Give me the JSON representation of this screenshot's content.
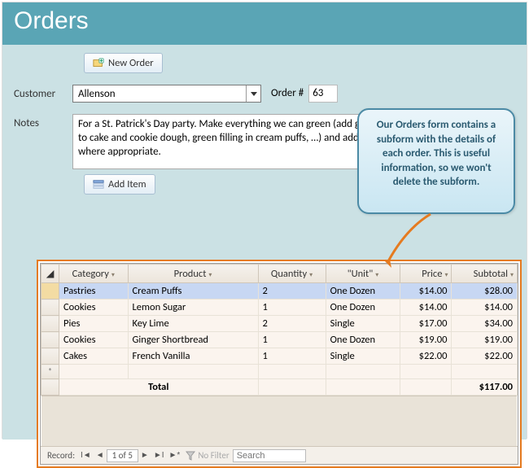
{
  "header": {
    "title": "Orders"
  },
  "buttons": {
    "newOrder": "New Order",
    "addItem": "Add Item"
  },
  "labels": {
    "customer": "Customer",
    "notes": "Notes",
    "orderNum": "Order #",
    "total": "Total",
    "filter": "No Filter"
  },
  "customer": {
    "value": "Allenson"
  },
  "orderNum": "63",
  "notes": "For a St. Patrick's Day party. Make everything we can green (add green food coloring to cake and cookie dough, green filling in cream puffs, …) and add on green sprinkles where appropriate.",
  "columns": {
    "category": "Category",
    "product": "Product",
    "quantity": "Quantity",
    "unit": "\"Unit\"",
    "price": "Price",
    "subtotal": "Subtotal"
  },
  "rows": [
    {
      "category": "Pastries",
      "product": "Cream Puffs",
      "quantity": "2",
      "unit": "One Dozen",
      "price": "$14.00",
      "subtotal": "$28.00"
    },
    {
      "category": "Cookies",
      "product": "Lemon Sugar",
      "quantity": "1",
      "unit": "One Dozen",
      "price": "$14.00",
      "subtotal": "$14.00"
    },
    {
      "category": "Pies",
      "product": "Key Lime",
      "quantity": "2",
      "unit": "Single",
      "price": "$17.00",
      "subtotal": "$34.00"
    },
    {
      "category": "Cookies",
      "product": "Ginger Shortbread",
      "quantity": "1",
      "unit": "One Dozen",
      "price": "$19.00",
      "subtotal": "$19.00"
    },
    {
      "category": "Cakes",
      "product": "French Vanilla",
      "quantity": "1",
      "unit": "Single",
      "price": "$22.00",
      "subtotal": "$22.00"
    }
  ],
  "grandTotal": "$117.00",
  "recordNav": {
    "label": "Record:",
    "pos": "1 of 5"
  },
  "searchPlaceholder": "Search",
  "callout": "Our Orders form contains a subform with the details of each order. This is useful information, so we won't delete the subform."
}
